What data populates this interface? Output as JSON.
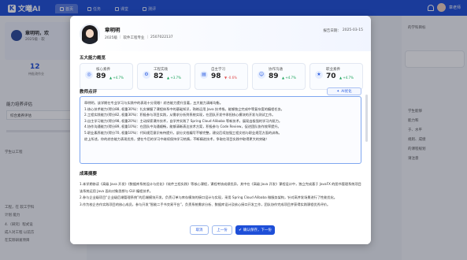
{
  "app": {
    "logo_text": "文曦AI"
  },
  "nav": {
    "tabs": [
      {
        "label": "首页",
        "icon": "home-icon"
      },
      {
        "label": "任务",
        "icon": "task-icon"
      },
      {
        "label": "课堂",
        "icon": "classroom-icon"
      },
      {
        "label": "测评",
        "icon": "exam-icon"
      }
    ],
    "active_tab": 0
  },
  "background": {
    "left_title": "章明明，欢",
    "left_sub": "2025级 · 软",
    "stat_value": "12",
    "stat_label": "待批改作业",
    "section_label": "能力培养评估",
    "input_text": "综合素养评估",
    "para1": "学生以工程",
    "para_lines": [
      "工程，在 软工学科",
      "计划 能力",
      "4.（研究）程式设",
      "成人对工程 以前方",
      "在实际研发项目"
    ],
    "right_lines": [
      "的学科目标",
      "学生能够",
      "能力和",
      "于、水平",
      "规则、成绩",
      "的课程规划",
      "请注意"
    ]
  },
  "student": {
    "name": "章明明",
    "grade": "2025级",
    "major": "软件工程专业",
    "id": "2507022137",
    "report_date_label": "报告日期：",
    "report_date": "2025-03-15"
  },
  "abilities": {
    "title": "五大能力概览",
    "items": [
      {
        "label": "核心素养",
        "value": "89",
        "delta": "+4.7%",
        "trend": "up",
        "icon": "target-icon"
      },
      {
        "label": "工程实践",
        "value": "82",
        "delta": "+3.7%",
        "trend": "up",
        "icon": "tool-icon"
      },
      {
        "label": "自主学习",
        "value": "98",
        "delta": "-0.6%",
        "trend": "down",
        "icon": "book-icon"
      },
      {
        "label": "协作沟通",
        "value": "89",
        "delta": "+4.7%",
        "trend": "up",
        "icon": "team-icon"
      },
      {
        "label": "职业素养",
        "value": "70",
        "delta": "+4.7%",
        "trend": "up",
        "icon": "badge-icon"
      }
    ]
  },
  "evaluation": {
    "title": "教师点评",
    "ai_button": "AI优化",
    "lines": [
      "章明明，该学期在专业学习与实践中的表现十分亮眼！综合能力提升显著，五大能力清晰均衡。",
      "1.核心技术能力(得分88, 权重30%)：扎实掌握了课程体系中的基础知识，熟练运用 Java 技术栈，能够独立完成中等复杂度的编程任务。",
      "2.工程实践能力(得分82, 权重30%)：积极参与项目实践，从需求分析到系统实现，在团队开发中承担核心模块的开发与测试工作。",
      "3.自主学习能力(得分98, 权重20%)：主动探索课外技术，自学并实践了 Spring Cloud Alibaba 等新技术，展现出极强的学习内驱力。",
      "4.协作沟通能力(得分89, 权重10%)：在团队中沟通顺畅，能够清晰表达技术方案，积极参与 Code Review，促进团队协作效率提升。",
      "5.职业素养能力(得分70, 权重10%)：代码规范意识有待提升，部分文档编写不够完整，建议后续加强工程文档与职业规范方面的训练。",
      "综上所述，你的综合能力表现优秀，望在今后的学习中继续保持学习热情，不断精进技术，争取在项目实践中取得更大的突破！"
    ]
  },
  "summary": {
    "title": "成果摘要",
    "lines": [
      "1.本学期修读《高级 Java 开发》《数据库系统设计与优化》《软件工程实践》等核心课程，课程考核成绩优异，其中在《高级 Java 开发》课程设计中，独立完成基于 JavaFX 的图书管理系统项目。",
      "该系统运用 Java 面向对象思想与 GUI 编程技术。",
      "2.参与企业级项目“企业级后端管理系统”的后端模块开发，负责订单与库存模块的接口设计与实现，采用 Spring Cloud Alibaba 微服务架构，针对高并发场景进行了性能优化。",
      "3.作为校企合作实践项目的核心成员，参与开发“智能二手书交易平台”，负责系统需求分析、数据库设计及核心接口开发工作，团队协作完成项目并获得实践课程优秀评价。"
    ]
  },
  "buttons": {
    "cancel": "取消",
    "prev": "上一份",
    "next": "确认保存，下一份"
  },
  "header_right": {
    "user": "章老师"
  },
  "colors": {
    "primary": "#1e4fd8",
    "up": "#1aa35a",
    "down": "#e04b4b"
  }
}
